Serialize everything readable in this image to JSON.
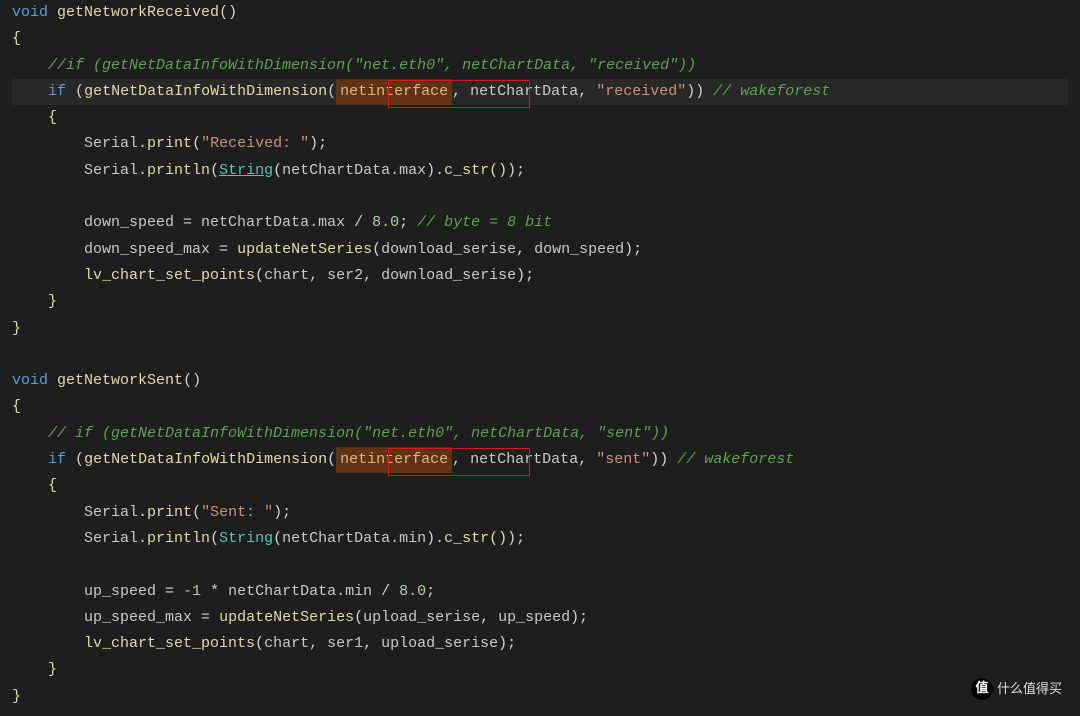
{
  "code": {
    "fn1": {
      "keyword_void": "void",
      "name": "getNetworkReceived",
      "comment_if": "//if (getNetDataInfoWithDimension(\"net.eth0\", netChartData, \"received\"))",
      "if_keyword": "if",
      "call_fn": "getNetDataInfoWithDimension",
      "arg1_highlighted": "netinterface",
      "arg2": "netChartData",
      "arg3": "\"received\"",
      "comment_end": "// wakeforest",
      "serial_print": "Serial.print",
      "received_label": "\"Received: \"",
      "serial_println": "Serial.println",
      "string_type": "String",
      "prop_max": "netChartData.max",
      "cstr_call": ".c_str()",
      "down_speed": "down_speed",
      "equals": " = ",
      "netchartmax": "netChartData.max",
      "div8": " / ",
      "num8": "8.0",
      "comment_byte": "// byte = 8 bit",
      "down_speed_max": "down_speed_max",
      "updateNetSeries": "updateNetSeries",
      "download_serise": "download_serise",
      "lv_chart": "lv_chart_set_points",
      "chart": "chart",
      "ser2": "ser2"
    },
    "fn2": {
      "keyword_void": "void",
      "name": "getNetworkSent",
      "comment_if": "// if (getNetDataInfoWithDimension(\"net.eth0\", netChartData, \"sent\"))",
      "if_keyword": "if",
      "call_fn": "getNetDataInfoWithDimension",
      "arg1_highlighted": "netinterface",
      "arg2": "netChartData",
      "arg3": "\"sent\"",
      "comment_end": "// wakeforest",
      "serial_print": "Serial.print",
      "sent_label": "\"Sent: \"",
      "serial_println": "Serial.println",
      "string_type": "String",
      "prop_min": "netChartData.min",
      "cstr_call": ".c_str()",
      "up_speed": "up_speed",
      "neg1": "-1",
      "mult": " * ",
      "netchartmin": "netChartData.min",
      "div8": " / ",
      "num8": "8.0",
      "up_speed_max": "up_speed_max",
      "updateNetSeries": "updateNetSeries",
      "upload_serise": "upload_serise",
      "lv_chart": "lv_chart_set_points",
      "chart": "chart",
      "ser1": "ser1"
    }
  },
  "watermark": {
    "icon": "值",
    "text": "什么值得买"
  }
}
